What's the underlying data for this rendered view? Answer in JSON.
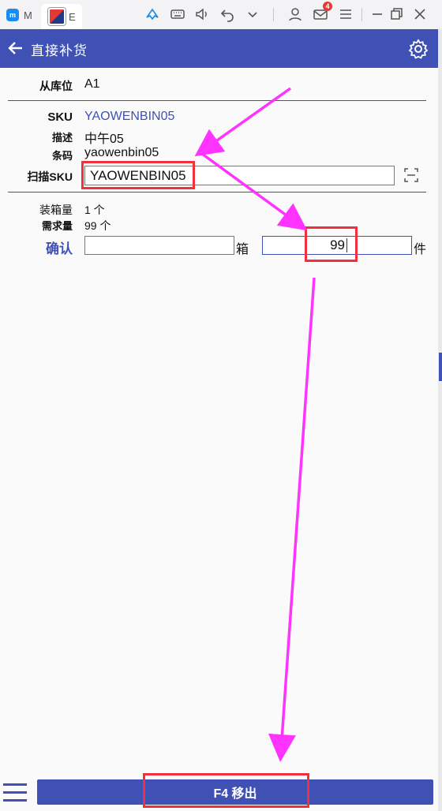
{
  "emulator": {
    "tab1_label": "M",
    "tab2_label": "E",
    "notification_count": "4"
  },
  "header": {
    "title": "直接补货"
  },
  "form": {
    "from_location_label": "从库位",
    "from_location_value": "A1",
    "sku_label": "SKU",
    "sku_value": "YAOWENBIN05",
    "desc_label": "描述",
    "desc_value": "中午05",
    "barcode_label": "条码",
    "barcode_value": "yaowenbin05",
    "scan_sku_label": "扫描SKU",
    "scan_sku_value": "YAOWENBIN05",
    "case_qty_label": "装箱量",
    "case_qty_value": "1 个",
    "required_qty_label": "需求量",
    "required_qty_value": "99 个",
    "confirm_label": "确认",
    "box_value": "",
    "box_unit": "箱",
    "piece_value": "99",
    "piece_unit": "件"
  },
  "footer": {
    "action_label": "F4 移出"
  },
  "colors": {
    "primary": "#3f51b5",
    "annotation_red": "#f0303c",
    "annotation_arrow": "#ff33ff"
  }
}
